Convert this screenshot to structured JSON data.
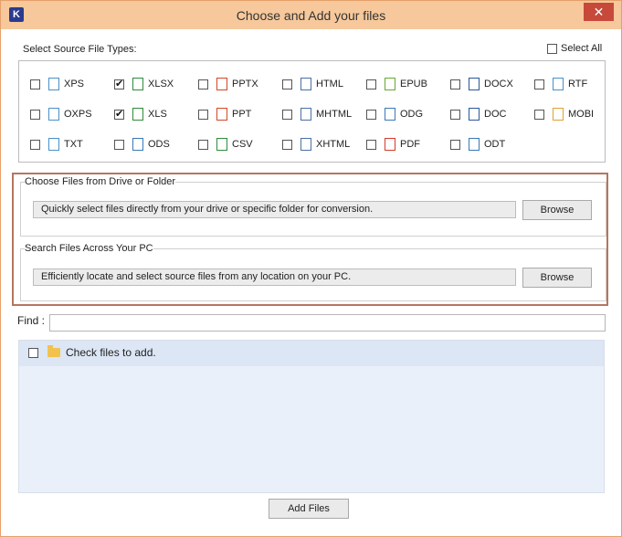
{
  "window": {
    "title": "Choose and Add your files",
    "app_icon": "K",
    "close": "✕"
  },
  "source_types": {
    "label": "Select Source File Types:",
    "select_all": "Select All",
    "items": [
      {
        "label": "XPS",
        "checked": false,
        "icon": "xps-icon",
        "color": "#4a90c8"
      },
      {
        "label": "XLSX",
        "checked": true,
        "icon": "xlsx-icon",
        "color": "#2e8b3a"
      },
      {
        "label": "PPTX",
        "checked": false,
        "icon": "pptx-icon",
        "color": "#d24726"
      },
      {
        "label": "HTML",
        "checked": false,
        "icon": "html-icon",
        "color": "#4a6fa5"
      },
      {
        "label": "EPUB",
        "checked": false,
        "icon": "epub-icon",
        "color": "#6aa636"
      },
      {
        "label": "DOCX",
        "checked": false,
        "icon": "docx-icon",
        "color": "#2b579a"
      },
      {
        "label": "RTF",
        "checked": false,
        "icon": "rtf-icon",
        "color": "#4a90c8"
      },
      {
        "label": "OXPS",
        "checked": false,
        "icon": "oxps-icon",
        "color": "#4a90c8"
      },
      {
        "label": "XLS",
        "checked": true,
        "icon": "xls-icon",
        "color": "#2e8b3a"
      },
      {
        "label": "PPT",
        "checked": false,
        "icon": "ppt-icon",
        "color": "#d24726"
      },
      {
        "label": "MHTML",
        "checked": false,
        "icon": "mhtml-icon",
        "color": "#4a6fa5"
      },
      {
        "label": "ODG",
        "checked": false,
        "icon": "odg-icon",
        "color": "#3a78b8"
      },
      {
        "label": "DOC",
        "checked": false,
        "icon": "doc-icon",
        "color": "#2b579a"
      },
      {
        "label": "MOBI",
        "checked": false,
        "icon": "mobi-icon",
        "color": "#e0a030"
      },
      {
        "label": "TXT",
        "checked": false,
        "icon": "txt-icon",
        "color": "#4a90c8"
      },
      {
        "label": "ODS",
        "checked": false,
        "icon": "ods-icon",
        "color": "#3a78b8"
      },
      {
        "label": "CSV",
        "checked": false,
        "icon": "csv-icon",
        "color": "#2e8b3a"
      },
      {
        "label": "XHTML",
        "checked": false,
        "icon": "xhtml-icon",
        "color": "#4a6fa5"
      },
      {
        "label": "PDF",
        "checked": false,
        "icon": "pdf-icon",
        "color": "#d03a2a"
      },
      {
        "label": "ODT",
        "checked": false,
        "icon": "odt-icon",
        "color": "#3a78b8"
      }
    ]
  },
  "drive_group": {
    "title": "Choose Files from Drive or Folder",
    "info": "Quickly select files directly from your drive or specific folder for conversion.",
    "button": "Browse"
  },
  "search_group": {
    "title": "Search Files Across Your PC",
    "info": "Efficiently locate and select source files from any location on your PC.",
    "button": "Browse"
  },
  "find": {
    "label": "Find :",
    "value": ""
  },
  "file_list": {
    "row_text": "Check files to add."
  },
  "footer": {
    "add_files": "Add Files"
  },
  "colors": {
    "accent_border": "#b5765f",
    "titlebar": "#f6c89b",
    "close": "#c7493a"
  }
}
